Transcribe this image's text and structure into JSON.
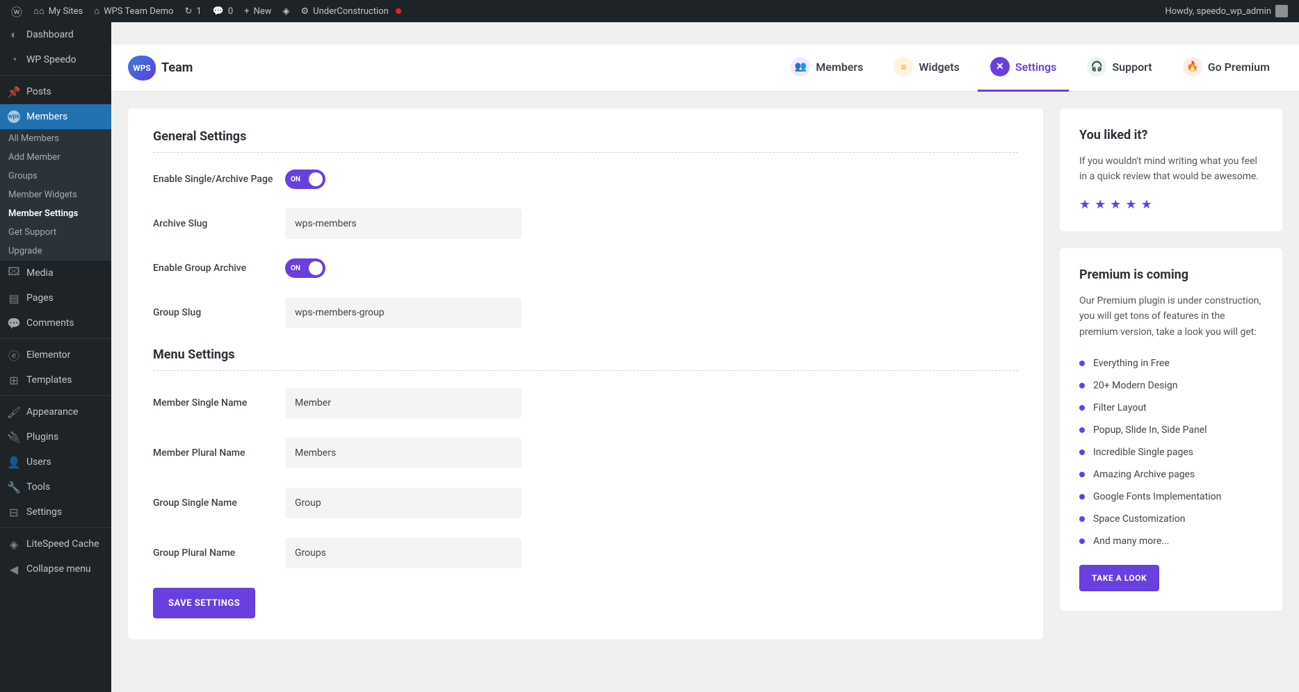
{
  "adminBar": {
    "mySites": "My Sites",
    "siteName": "WPS Team Demo",
    "updates": "1",
    "comments": "0",
    "new": "New",
    "construction": "UnderConstruction",
    "howdy": "Howdy, speedo_wp_admin"
  },
  "sidebar": {
    "dashboard": "Dashboard",
    "wpSpeedo": "WP Speedo",
    "posts": "Posts",
    "members": "Members",
    "sub": {
      "allMembers": "All Members",
      "addMember": "Add Member",
      "groups": "Groups",
      "memberWidgets": "Member Widgets",
      "memberSettings": "Member Settings",
      "getSupport": "Get Support",
      "upgrade": "Upgrade"
    },
    "media": "Media",
    "pages": "Pages",
    "commentsItem": "Comments",
    "elementor": "Elementor",
    "templates": "Templates",
    "appearance": "Appearance",
    "plugins": "Plugins",
    "users": "Users",
    "tools": "Tools",
    "settings": "Settings",
    "litespeed": "LiteSpeed Cache",
    "collapse": "Collapse menu"
  },
  "header": {
    "brandBadge": "WPS",
    "brandText": "Team",
    "nav": {
      "members": "Members",
      "widgets": "Widgets",
      "settings": "Settings",
      "support": "Support",
      "premium": "Go Premium"
    }
  },
  "settingsPanel": {
    "generalTitle": "General Settings",
    "menuTitle": "Menu Settings",
    "toggleOn": "ON",
    "labels": {
      "enableSingle": "Enable Single/Archive Page",
      "archiveSlug": "Archive Slug",
      "enableGroup": "Enable Group Archive",
      "groupSlug": "Group Slug",
      "memberSingle": "Member Single Name",
      "memberPlural": "Member Plural Name",
      "groupSingle": "Group Single Name",
      "groupPlural": "Group Plural Name"
    },
    "values": {
      "archiveSlug": "wps-members",
      "groupSlug": "wps-members-group",
      "memberSingle": "Member",
      "memberPlural": "Members",
      "groupSingle": "Group",
      "groupPlural": "Groups"
    },
    "saveBtn": "SAVE SETTINGS"
  },
  "sidebarCards": {
    "liked": {
      "title": "You liked it?",
      "text": "If you wouldn't mind writing what you feel in a quick review that would be awesome."
    },
    "premium": {
      "title": "Premium is coming",
      "text": "Our Premium plugin is under construction, you will get tons of features in the premium version, take a look you will get:",
      "features": [
        "Everything in Free",
        "20+ Modern Design",
        "Filter Layout",
        "Popup, Slide In, Side Panel",
        "Incredible Single pages",
        "Amazing Archive pages",
        "Google Fonts Implementation",
        "Space Customization",
        "And many more..."
      ],
      "cta": "TAKE A LOOK"
    }
  }
}
